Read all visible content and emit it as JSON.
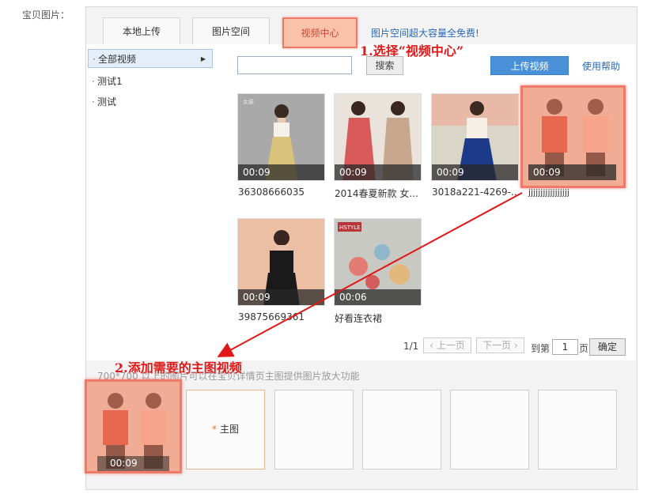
{
  "field_label": "宝贝图片：",
  "tabs": [
    {
      "label": "本地上传"
    },
    {
      "label": "图片空间"
    },
    {
      "label": "视频中心"
    }
  ],
  "promo_link": "图片空间超大容量全免费!",
  "annotations": {
    "step1": "1.选择“视频中心”",
    "step2": "2.添加需要的主图视频"
  },
  "sidebar": {
    "items": [
      {
        "label": "全部视频"
      },
      {
        "label": "测试1"
      },
      {
        "label": "测试"
      }
    ]
  },
  "search": {
    "placeholder": "",
    "button": "搜索"
  },
  "toolbar": {
    "upload": "上传视频",
    "help": "使用帮助"
  },
  "videos": [
    {
      "duration": "00:09",
      "caption": "36308666035",
      "brand": "女装"
    },
    {
      "duration": "00:09",
      "caption": "2014春夏新款 女..."
    },
    {
      "duration": "00:09",
      "caption": "3018a221-4269-..."
    },
    {
      "duration": "00:09",
      "caption": "jjjjjjjjjjjjjjjjj"
    },
    {
      "duration": "00:09",
      "caption": "39875669361"
    },
    {
      "duration": "00:06",
      "caption": "好看连衣裙",
      "brand": "HSTYLE"
    }
  ],
  "pager": {
    "page_info": "1/1",
    "prev": "上一页",
    "next": "下一页",
    "goto_prefix": "到第",
    "page_value": "1",
    "goto_suffix": "页",
    "confirm": "确定"
  },
  "hint": "700*700 以上的图片可以在宝贝详情页主图提供图片放大功能",
  "slots": {
    "selected_duration": "00:09",
    "main_label": "主图",
    "main_star": "*"
  },
  "colors": {
    "highlight": "#f07a6a",
    "upload_button": "#4a90d9",
    "link": "#2a6ab8",
    "annotation": "#e01818"
  }
}
